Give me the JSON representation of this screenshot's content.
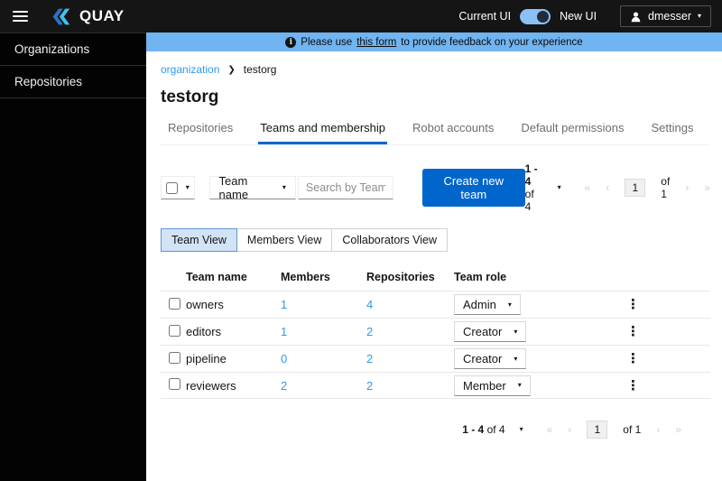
{
  "header": {
    "brand": "QUAY",
    "current_ui_label": "Current UI",
    "new_ui_label": "New UI",
    "user": "dmesser"
  },
  "sidebar": {
    "items": [
      {
        "label": "Organizations"
      },
      {
        "label": "Repositories"
      }
    ]
  },
  "banner": {
    "prefix": "Please use",
    "link": "this form",
    "suffix": "to provide feedback on your experience",
    "info_icon": "i"
  },
  "breadcrumb": {
    "root": "organization",
    "current": "testorg"
  },
  "page": {
    "title": "testorg"
  },
  "tabs": [
    {
      "label": "Repositories",
      "active": false
    },
    {
      "label": "Teams and membership",
      "active": true
    },
    {
      "label": "Robot accounts",
      "active": false
    },
    {
      "label": "Default permissions",
      "active": false
    },
    {
      "label": "Settings",
      "active": false
    }
  ],
  "toolbar": {
    "filter_label": "Team name",
    "search_placeholder": "Search by Team na...",
    "create_button": "Create new team"
  },
  "pagination": {
    "range": "1 - 4",
    "total": "of 4",
    "first": "«",
    "prev": "‹",
    "page": "1",
    "pages": "of 1",
    "next": "›",
    "last": "»"
  },
  "view_toggle": {
    "options": [
      {
        "label": "Team View",
        "selected": true
      },
      {
        "label": "Members View",
        "selected": false
      },
      {
        "label": "Collaborators View",
        "selected": false
      }
    ]
  },
  "table": {
    "columns": [
      "Team name",
      "Members",
      "Repositories",
      "Team role"
    ],
    "rows": [
      {
        "name": "owners",
        "members": "1",
        "repositories": "4",
        "role": "Admin"
      },
      {
        "name": "editors",
        "members": "1",
        "repositories": "2",
        "role": "Creator"
      },
      {
        "name": "pipeline",
        "members": "0",
        "repositories": "2",
        "role": "Creator"
      },
      {
        "name": "reviewers",
        "members": "2",
        "repositories": "2",
        "role": "Member"
      }
    ]
  },
  "colors": {
    "primary": "#0066cc",
    "link": "#2b9af3",
    "banner_bg": "#70b4f1",
    "header_bg": "#151515",
    "selected_toggle_bg": "#d2e3f5"
  }
}
